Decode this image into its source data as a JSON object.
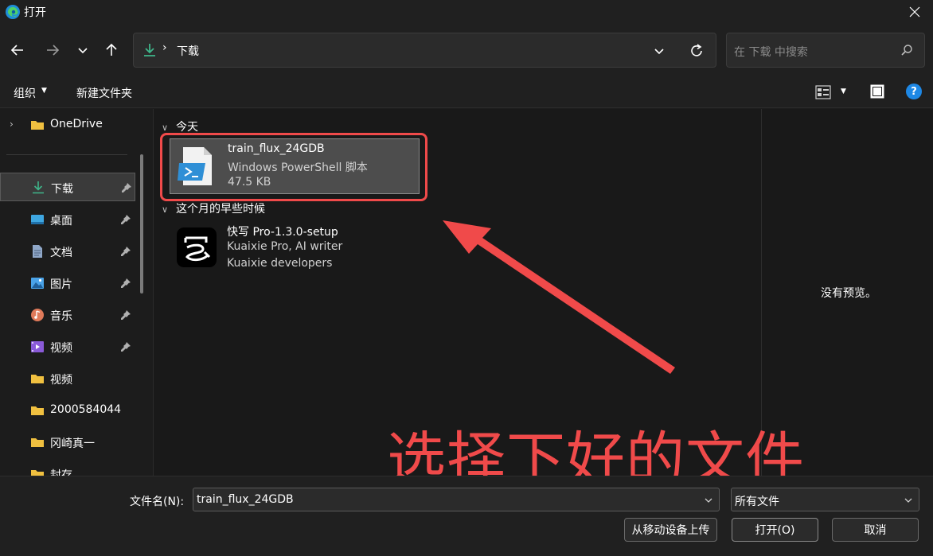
{
  "window": {
    "title": "打开"
  },
  "nav": {
    "location": "下载",
    "search_placeholder": "在 下载 中搜索"
  },
  "toolbar": {
    "organize_label": "组织",
    "new_folder_label": "新建文件夹"
  },
  "sidebar": {
    "items": [
      {
        "label": "OneDrive",
        "icon": "folder-icon",
        "pinned": false
      },
      {
        "label": "下载",
        "icon": "download-icon",
        "pinned": true,
        "selected": true
      },
      {
        "label": "桌面",
        "icon": "desktop-icon",
        "pinned": true
      },
      {
        "label": "文档",
        "icon": "document-icon",
        "pinned": true
      },
      {
        "label": "图片",
        "icon": "pictures-icon",
        "pinned": true
      },
      {
        "label": "音乐",
        "icon": "music-icon",
        "pinned": true
      },
      {
        "label": "视频",
        "icon": "video-icon",
        "pinned": true
      },
      {
        "label": "视频",
        "icon": "folder-icon",
        "pinned": false
      },
      {
        "label": "2000584044",
        "icon": "folder-icon",
        "pinned": false
      },
      {
        "label": "冈崎真一",
        "icon": "folder-icon",
        "pinned": false
      },
      {
        "label": "封存",
        "icon": "folder-icon",
        "pinned": false
      }
    ]
  },
  "content": {
    "groups": [
      {
        "header": "今天",
        "files": [
          {
            "name": "train_flux_24GDB",
            "type": "Windows PowerShell 脚本",
            "size": "47.5 KB",
            "selected": true
          }
        ]
      },
      {
        "header": "这个月的早些时候",
        "files": [
          {
            "name": "快写 Pro-1.3.0-setup",
            "type": "Kuaixie Pro, AI writer",
            "size": "Kuaixie developers",
            "selected": false
          }
        ]
      }
    ]
  },
  "preview": {
    "text": "没有预览。"
  },
  "annotation": {
    "text": "选择下好的文件",
    "color": "#f04a4a"
  },
  "bottom": {
    "filename_label": "文件名(N):",
    "filename_value": "train_flux_24GDB",
    "filetype_value": "所有文件",
    "upload_button": "从移动设备上传",
    "open_button": "打开(O)",
    "cancel_button": "取消"
  },
  "colors": {
    "background": "#1c1c1c",
    "accent_blue": "#1e88e5",
    "download_green": "#3fb68b",
    "folder_yellow": "#f0c040",
    "annotation_red": "#f04a4a"
  }
}
